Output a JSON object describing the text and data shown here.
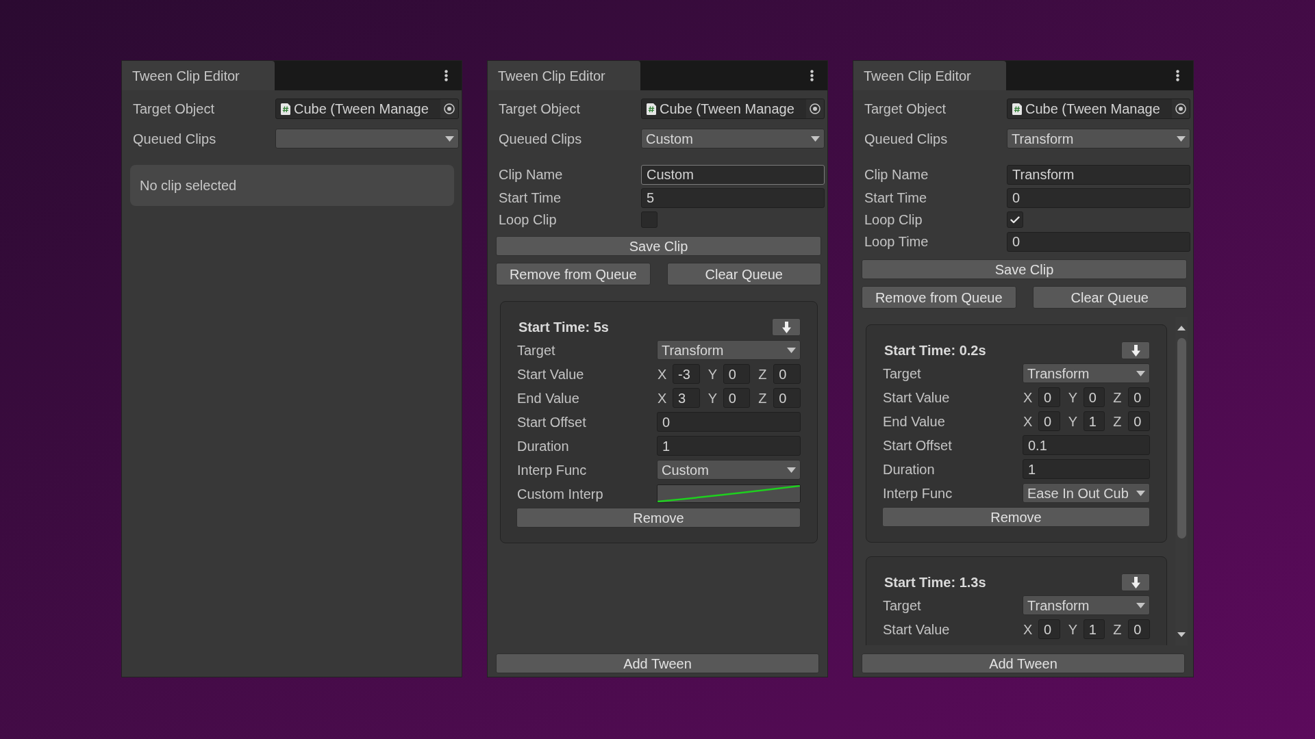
{
  "panels": [
    {
      "tab": "Tween Clip Editor",
      "target_object": {
        "label": "Target Object",
        "value": "Cube (Tween Manage"
      },
      "queued_clips": {
        "label": "Queued Clips"
      },
      "message": "No clip selected"
    },
    {
      "tab": "Tween Clip Editor",
      "target_object": {
        "label": "Target Object",
        "value": "Cube (Tween Manage"
      },
      "queued_clips": {
        "label": "Queued Clips",
        "value": "Custom"
      },
      "clip_fields": [
        {
          "kind": "text",
          "label": "Clip Name",
          "value": "Custom",
          "focused": true
        },
        {
          "kind": "text",
          "label": "Start Time",
          "value": "5",
          "focused": false
        },
        {
          "kind": "checkbox",
          "label": "Loop Clip",
          "checked": false
        }
      ],
      "save_button": "Save Clip",
      "queue_buttons": [
        "Remove from Queue",
        "Clear Queue"
      ],
      "scrollable": false,
      "tweens": [
        {
          "title": "Start Time: 5s",
          "fields": [
            {
              "kind": "dropdown",
              "label": "Target",
              "value": "Transform"
            },
            {
              "kind": "vector",
              "label": "Start Value",
              "components": [
                {
                  "axis": "X",
                  "value": "-3"
                },
                {
                  "axis": "Y",
                  "value": "0"
                },
                {
                  "axis": "Z",
                  "value": "0"
                }
              ]
            },
            {
              "kind": "vector",
              "label": "End Value",
              "components": [
                {
                  "axis": "X",
                  "value": "3"
                },
                {
                  "axis": "Y",
                  "value": "0"
                },
                {
                  "axis": "Z",
                  "value": "0"
                }
              ]
            },
            {
              "kind": "number",
              "label": "Start Offset",
              "value": "0"
            },
            {
              "kind": "number",
              "label": "Duration",
              "value": "1"
            },
            {
              "kind": "dropdown",
              "label": "Interp Func",
              "value": "Custom"
            },
            {
              "kind": "curve",
              "label": "Custom Interp"
            }
          ],
          "remove_button": "Remove"
        }
      ],
      "add_button": "Add Tween"
    },
    {
      "tab": "Tween Clip Editor",
      "target_object": {
        "label": "Target Object",
        "value": "Cube (Tween Manage"
      },
      "queued_clips": {
        "label": "Queued Clips",
        "value": "Transform"
      },
      "clip_fields": [
        {
          "kind": "text",
          "label": "Clip Name",
          "value": "Transform",
          "focused": false
        },
        {
          "kind": "text",
          "label": "Start Time",
          "value": "0",
          "focused": false
        },
        {
          "kind": "checkbox",
          "label": "Loop Clip",
          "checked": true
        },
        {
          "kind": "text",
          "label": "Loop Time",
          "value": "0",
          "focused": false
        }
      ],
      "save_button": "Save Clip",
      "queue_buttons": [
        "Remove from Queue",
        "Clear Queue"
      ],
      "scrollable": true,
      "tweens": [
        {
          "title": "Start Time: 0.2s",
          "fields": [
            {
              "kind": "dropdown",
              "label": "Target",
              "value": "Transform"
            },
            {
              "kind": "vector",
              "label": "Start Value",
              "components": [
                {
                  "axis": "X",
                  "value": "0"
                },
                {
                  "axis": "Y",
                  "value": "0"
                },
                {
                  "axis": "Z",
                  "value": "0"
                }
              ]
            },
            {
              "kind": "vector",
              "label": "End Value",
              "components": [
                {
                  "axis": "X",
                  "value": "0"
                },
                {
                  "axis": "Y",
                  "value": "1"
                },
                {
                  "axis": "Z",
                  "value": "0"
                }
              ]
            },
            {
              "kind": "number",
              "label": "Start Offset",
              "value": "0.1"
            },
            {
              "kind": "number",
              "label": "Duration",
              "value": "1"
            },
            {
              "kind": "dropdown",
              "label": "Interp Func",
              "value": "Ease In Out Cub"
            }
          ],
          "remove_button": "Remove"
        },
        {
          "title": "Start Time: 1.3s",
          "fields": [
            {
              "kind": "dropdown",
              "label": "Target",
              "value": "Transform"
            },
            {
              "kind": "vector",
              "label": "Start Value",
              "components": [
                {
                  "axis": "X",
                  "value": "0"
                },
                {
                  "axis": "Y",
                  "value": "1"
                },
                {
                  "axis": "Z",
                  "value": "0"
                }
              ]
            }
          ]
        }
      ],
      "add_button": "Add Tween"
    }
  ]
}
